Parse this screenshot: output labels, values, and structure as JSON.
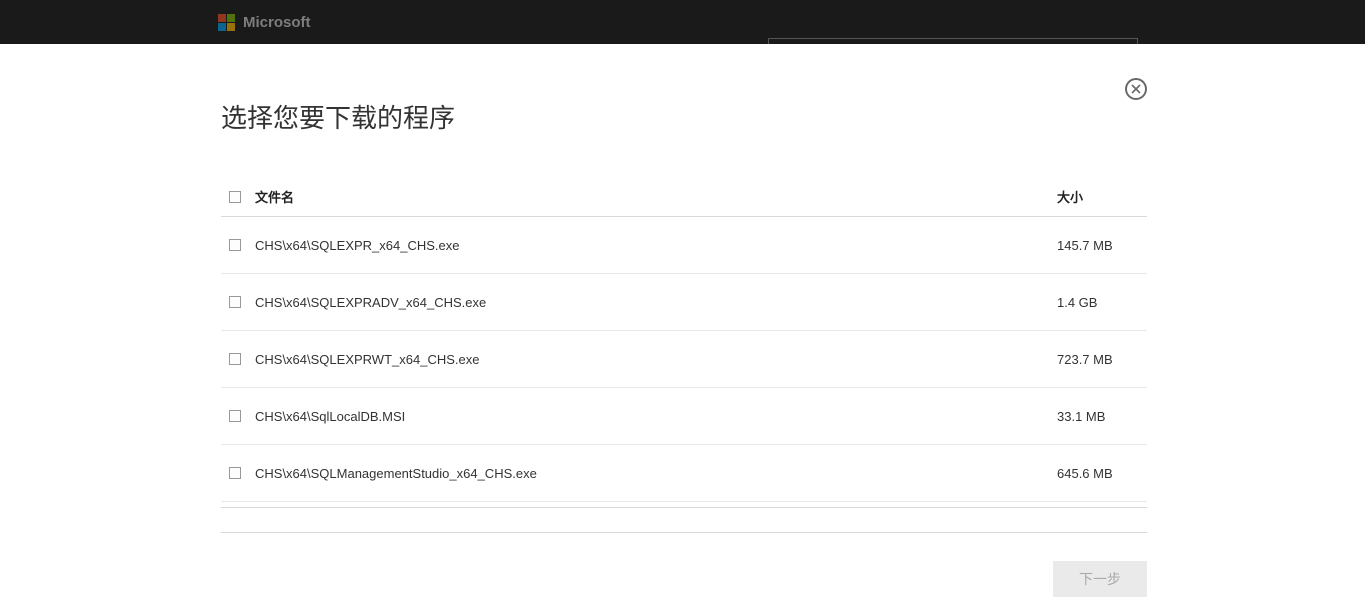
{
  "header": {
    "brand": "Microsoft"
  },
  "dialog": {
    "title": "选择您要下载的程序",
    "columns": {
      "filename": "文件名",
      "size": "大小"
    },
    "rows": [
      {
        "name": "CHS\\x64\\SQLEXPR_x64_CHS.exe",
        "size": "145.7 MB"
      },
      {
        "name": "CHS\\x64\\SQLEXPRADV_x64_CHS.exe",
        "size": "1.4 GB"
      },
      {
        "name": "CHS\\x64\\SQLEXPRWT_x64_CHS.exe",
        "size": "723.7 MB"
      },
      {
        "name": "CHS\\x64\\SqlLocalDB.MSI",
        "size": "33.1 MB"
      },
      {
        "name": "CHS\\x64\\SQLManagementStudio_x64_CHS.exe",
        "size": "645.6 MB"
      }
    ],
    "nextButton": "下一步"
  }
}
